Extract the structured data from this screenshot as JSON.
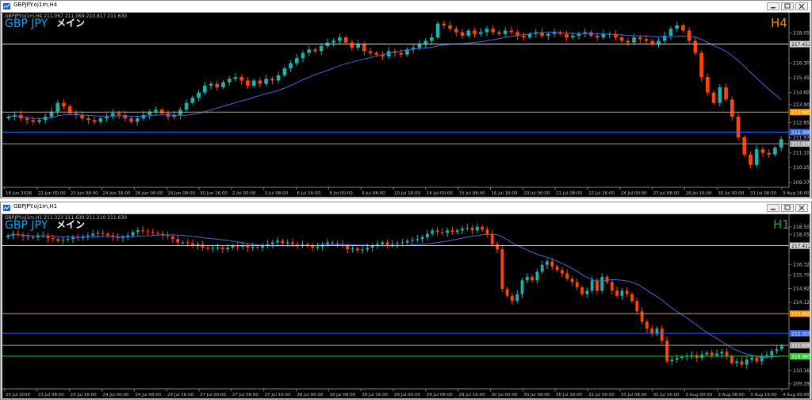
{
  "colors": {
    "bg": "#000000",
    "up": "#20b2aa",
    "down": "#ff4500",
    "ma": "#4169e1",
    "axis": "#c0c0c0",
    "hline_white": "#d8d8d8",
    "hline_orange": "#ff9900",
    "hline_blue": "#3366ff",
    "hline_grey": "#a0a0a0",
    "hline_green": "#33cc33",
    "symbol": "#00a8ff",
    "label": "#ffffff",
    "timeframe": "#ff8c00",
    "timeframe_h1": "#22aa22"
  },
  "icons": {
    "app": "chart-icon",
    "minimize": "minimize-icon",
    "maximize": "maximize-icon",
    "close": "close-icon"
  },
  "windows": [
    {
      "title": "GBPJPY.oj1m,H4",
      "info": "GBPJPY.oj1m,H4  211.067 211.069 210.817 211.630",
      "symbol": "GBP JPY",
      "label": "メイン",
      "timeframe": "H4",
      "price_labels": [
        "218.050",
        "217.412",
        "216.300",
        "215.450",
        "214.600",
        "213.900",
        "213.465",
        "212.850",
        "212.300",
        "211.975",
        "211.630",
        "211.100",
        "210.250",
        "209.375"
      ],
      "time_labels": [
        "18 Jun 2026",
        "22 Jun 00:00",
        "23 Jun 08:00",
        "24 Jun 16:00",
        "26 Jun 00:00",
        "29 Jun 08:00",
        "30 Jun 16:00",
        "2 Jul 00:00",
        "3 Jul 08:00",
        "6 Jul 16:00",
        "8 Jul 00:00",
        "9 Jul 08:00",
        "10 Jul 16:00",
        "14 Jul 00:00",
        "15 Jul 08:00",
        "16 Jul 16:00",
        "20 Jul 00:00",
        "21 Jul 08:00",
        "22 Jul 16:00",
        "24 Jul 00:00",
        "27 Jul 08:00",
        "28 Jul 16:00",
        "30 Jul 00:00",
        "31 Jul 08:00",
        "3 Aug 16:00"
      ],
      "hlines": [
        {
          "price": 217.412,
          "label": "217.412",
          "color": "white"
        },
        {
          "price": 213.465,
          "label": "213.465",
          "color": "orange"
        },
        {
          "price": 212.3,
          "label": "212.300",
          "color": "blue"
        },
        {
          "price": 211.63,
          "label": "211.630",
          "color": "grey"
        }
      ]
    },
    {
      "title": "GBPJPY.oj1m,H1",
      "info": "GBPJPY.oj1m,H1  211.323 211.639 211.210 211.630",
      "symbol": "GBP JPY",
      "label": "メイン",
      "timeframe": "H1",
      "price_labels": [
        "218.500",
        "218.050",
        "217.412",
        "216.320",
        "215.700",
        "214.920",
        "214.120",
        "213.465",
        "212.320",
        "211.630",
        "210.993",
        "210.165",
        "209.390"
      ],
      "time_labels": [
        "23 Jul 2026",
        "23 Jul 08:00",
        "23 Jul 16:00",
        "24 Jul 00:00",
        "24 Jul 08:00",
        "24 Jul 16:00",
        "27 Jul 00:00",
        "27 Jul 08:00",
        "27 Jul 16:00",
        "28 Jul 00:00",
        "28 Jul 08:00",
        "28 Jul 16:00",
        "29 Jul 00:00",
        "29 Jul 08:00",
        "29 Jul 16:00",
        "30 Jul 00:00",
        "30 Jul 08:00",
        "30 Jul 16:00",
        "31 Jul 00:00",
        "31 Jul 08:00",
        "31 Jul 16:00",
        "3 Aug 00:00",
        "3 Aug 08:00",
        "3 Aug 16:00",
        "4 Aug 00:00"
      ],
      "hlines": [
        {
          "price": 217.412,
          "label": "217.412",
          "color": "white"
        },
        {
          "price": 213.465,
          "label": "213.465",
          "color": "orange"
        },
        {
          "price": 212.32,
          "label": "212.320",
          "color": "blue"
        },
        {
          "price": 211.63,
          "label": "211.630",
          "color": "grey"
        },
        {
          "price": 210.993,
          "label": "210.993",
          "color": "green"
        }
      ]
    }
  ],
  "chart_data": [
    {
      "type": "line",
      "title": "GBPJPY.oj1m,H4",
      "ylim": [
        209.1,
        219.05
      ],
      "series": [
        {
          "values": [
            213.2,
            213.3,
            213.1,
            213.0,
            212.9,
            213.0,
            213.2,
            213.5,
            214.0,
            213.8,
            213.4,
            213.3,
            213.1,
            213.0,
            212.9,
            213.1,
            213.2,
            213.4,
            213.3,
            213.1,
            212.9,
            213.1,
            213.3,
            213.5,
            213.6,
            213.4,
            213.2,
            213.3,
            213.6,
            214.0,
            214.3,
            214.6,
            215.0,
            215.1,
            214.9,
            215.2,
            215.4,
            215.5,
            215.3,
            215.0,
            215.3,
            215.1,
            215.4,
            215.3,
            215.6,
            216.0,
            216.3,
            216.6,
            216.9,
            217.1,
            217.0,
            217.3,
            217.5,
            217.6,
            217.8,
            217.5,
            217.2,
            217.4,
            217.0,
            216.9,
            216.8,
            216.7,
            217.0,
            216.9,
            216.8,
            217.1,
            217.2,
            217.4,
            217.6,
            217.8,
            218.6,
            218.5,
            218.3,
            218.1,
            217.9,
            218.2,
            218.0,
            218.1,
            218.3,
            218.1,
            218.0,
            218.2,
            218.1,
            217.9,
            217.8,
            218.0,
            218.1,
            217.9,
            218.0,
            218.1,
            218.0,
            217.8,
            217.9,
            218.0,
            218.1,
            217.9,
            217.8,
            218.0,
            218.0,
            217.8,
            217.6,
            217.5,
            217.8,
            217.7,
            217.6,
            217.4,
            217.6,
            217.9,
            218.3,
            218.5,
            218.2,
            217.6,
            216.9,
            215.5,
            214.6,
            214.0,
            214.9,
            214.2,
            213.2,
            212.0,
            211.0,
            210.4,
            211.3,
            211.1,
            211.0,
            211.4,
            211.9
          ]
        }
      ]
    },
    {
      "type": "line",
      "title": "GBPJPY.oj1m,H1",
      "ylim": [
        209.1,
        219.05
      ],
      "series": [
        {
          "values": [
            218.0,
            218.1,
            218.05,
            217.95,
            217.9,
            217.9,
            218.0,
            218.0,
            217.85,
            217.8,
            217.7,
            217.75,
            217.8,
            217.9,
            217.85,
            217.95,
            218.0,
            218.1,
            218.15,
            218.1,
            218.0,
            217.9,
            217.85,
            217.9,
            218.0,
            218.2,
            218.3,
            218.25,
            218.2,
            218.15,
            218.1,
            218.0,
            217.95,
            217.8,
            217.6,
            217.6,
            217.55,
            217.4,
            217.5,
            217.3,
            217.25,
            217.3,
            217.3,
            217.2,
            217.3,
            217.4,
            217.35,
            217.4,
            217.3,
            217.35,
            217.3,
            217.4,
            217.5,
            217.6,
            217.7,
            217.55,
            217.6,
            217.5,
            217.45,
            217.5,
            217.4,
            217.3,
            217.35,
            217.5,
            217.6,
            217.55,
            217.5,
            217.4,
            217.2,
            217.25,
            217.15,
            217.2,
            217.3,
            217.4,
            217.5,
            217.6,
            217.45,
            217.5,
            217.55,
            217.6,
            217.7,
            217.75,
            217.8,
            217.9,
            218.1,
            218.3,
            218.2,
            218.15,
            218.3,
            218.2,
            218.3,
            218.4,
            218.45,
            218.3,
            218.5,
            218.35,
            218.1,
            217.5,
            217.2,
            214.9,
            214.5,
            214.2,
            214.6,
            215.4,
            215.6,
            215.4,
            215.9,
            216.3,
            216.5,
            216.2,
            216.0,
            215.8,
            215.5,
            215.3,
            215.0,
            214.6,
            214.8,
            215.4,
            214.8,
            215.6,
            215.3,
            214.8,
            214.5,
            214.8,
            214.6,
            214.2,
            213.6,
            213.0,
            212.6,
            212.3,
            212.6,
            211.9,
            210.7,
            210.8,
            210.9,
            210.95,
            211.0,
            211.05,
            210.9,
            211.1,
            211.2,
            211.05,
            211.15,
            211.25,
            211.0,
            210.6,
            210.7,
            210.5,
            210.8,
            210.9,
            210.7,
            211.0,
            211.05,
            211.3,
            211.4,
            211.6
          ]
        }
      ]
    }
  ]
}
